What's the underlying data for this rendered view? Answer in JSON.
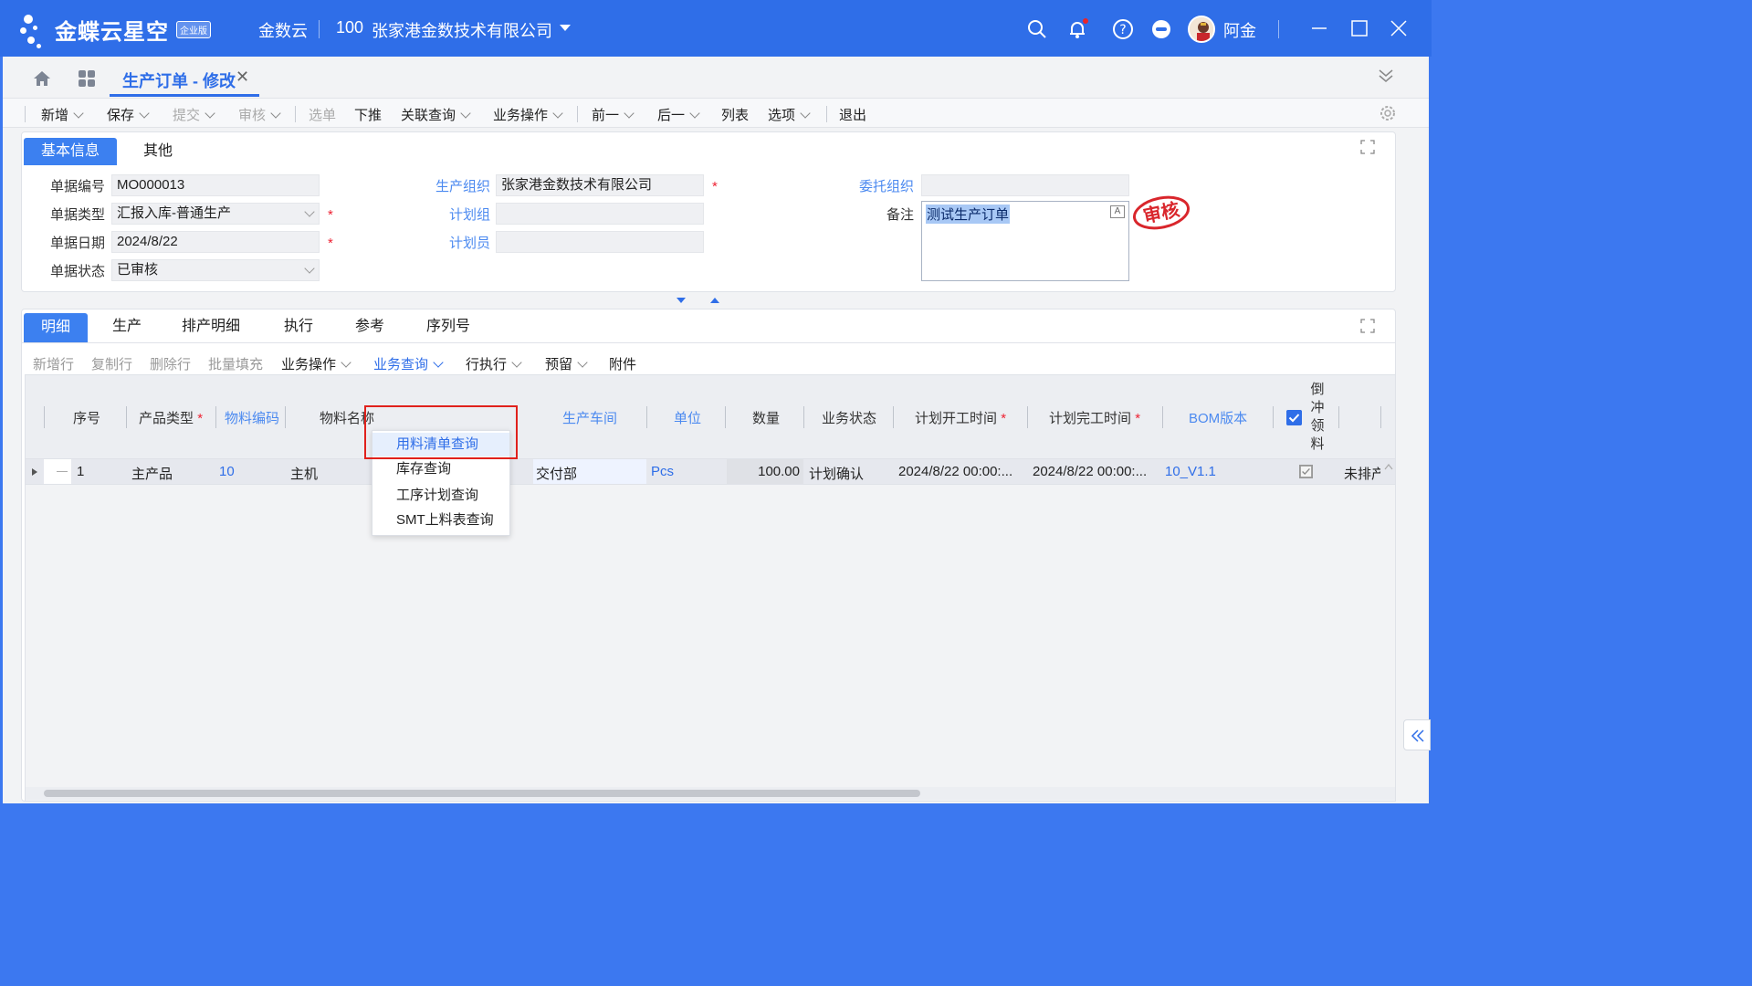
{
  "titlebar": {
    "brand": "金蝶云星空",
    "edition_badge": "企业版",
    "product": "金数云",
    "org_code": "100",
    "org_name": "张家港金数技术有限公司",
    "user_name": "阿金",
    "colors": {
      "bar": "#2f6ee8",
      "notification_dot": "#e8252a"
    }
  },
  "tabs": {
    "doc_tab_label": "生产订单 - 修改"
  },
  "toolbar": {
    "items": [
      "新增",
      "保存",
      "提交",
      "审核",
      "选单",
      "下推",
      "关联查询",
      "业务操作",
      "前一",
      "后一",
      "列表",
      "选项",
      "退出"
    ]
  },
  "header": {
    "tabs": [
      "基本信息",
      "其他"
    ],
    "fields": {
      "bill_no_label": "单据编号",
      "bill_no": "MO000013",
      "bill_type_label": "单据类型",
      "bill_type": "汇报入库-普通生产",
      "bill_date_label": "单据日期",
      "bill_date": "2024/8/22",
      "bill_status_label": "单据状态",
      "bill_status": "已审核",
      "prd_org_label": "生产组织",
      "prd_org": "张家港金数技术有限公司",
      "plan_group_label": "计划组",
      "plan_group": "",
      "planner_label": "计划员",
      "planner": "",
      "entrust_org_label": "委托组织",
      "entrust_org": "",
      "memo_label": "备注",
      "memo": "测试生产订单"
    },
    "stamp_text": "审核",
    "required_mark": "*"
  },
  "detail": {
    "tabs": [
      "明细",
      "生产",
      "排产明细",
      "执行",
      "参考",
      "序列号"
    ],
    "subtoolbar": [
      "新增行",
      "复制行",
      "删除行",
      "批量填充",
      "业务操作",
      "业务查询",
      "行执行",
      "预留",
      "附件"
    ],
    "columns": [
      "序号",
      "产品类型",
      "物料编码",
      "物料名称",
      "生产车间",
      "单位",
      "数量",
      "业务状态",
      "计划开工时间",
      "计划完工时间",
      "BOM版本",
      "倒冲领料"
    ],
    "backflush_header_chars": [
      "倒",
      "冲",
      "领",
      "料"
    ],
    "rows": [
      {
        "seq": "1",
        "product_type": "主产品",
        "material_code": "10",
        "material_name": "主机",
        "workshop": "交付部",
        "unit": "Pcs",
        "qty": "100.00",
        "biz_status": "计划确认",
        "plan_start": "2024/8/22 00:00:...",
        "plan_finish": "2024/8/22 00:00:...",
        "bom_version": "10_V1.1",
        "backflush": true,
        "extra": "未排产"
      }
    ]
  },
  "dropdown": {
    "items": [
      "用料清单查询",
      "库存查询",
      "工序计划查询",
      "SMT上料表查询"
    ],
    "highlighted_index": 0,
    "highlight_color": "#e0211c"
  }
}
